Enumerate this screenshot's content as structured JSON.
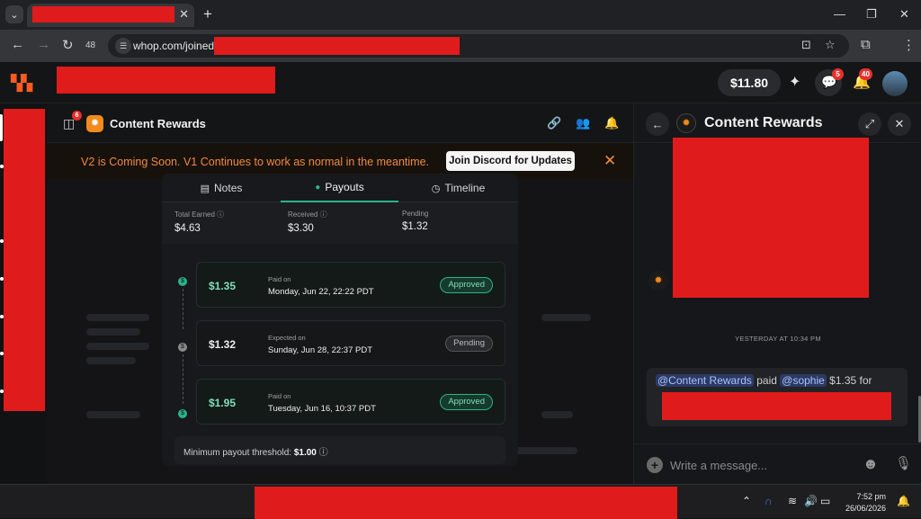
{
  "browser": {
    "tab_close": "✕",
    "new_tab": "+",
    "tab_count": "48",
    "url_prefix": "whop.com/joined/",
    "window_controls": {
      "minimize": "—",
      "restore": "❐",
      "close": "✕"
    }
  },
  "header": {
    "balance": "$11.80",
    "chat_badge": "5",
    "notif_badge": "40"
  },
  "main": {
    "panel_badge": "6",
    "app_title": "Content Rewards",
    "banner_text": "V2 is Coming Soon. V1 Continues to work as normal in the meantime.",
    "banner_button": "Join Discord for Updates",
    "tabs": [
      {
        "label": "Notes",
        "icon": "notes-icon"
      },
      {
        "label": "Payouts",
        "icon": "money-bag-icon"
      },
      {
        "label": "Timeline",
        "icon": "clock-icon"
      }
    ],
    "stats": [
      {
        "label": "Total Earned",
        "value": "$4.63"
      },
      {
        "label": "Received",
        "value": "$3.30"
      },
      {
        "label": "Pending",
        "value": "$1.32"
      }
    ],
    "payouts": [
      {
        "amount": "$1.35",
        "sublabel": "Paid on",
        "date": "Monday, Jun 22, 22:22 PDT",
        "status": "Approved"
      },
      {
        "amount": "$1.32",
        "sublabel": "Expected on",
        "date": "Sunday, Jun 28, 22:37 PDT",
        "status": "Pending"
      },
      {
        "amount": "$1.95",
        "sublabel": "Paid on",
        "date": "Tuesday, Jun 16, 10:37 PDT",
        "status": "Approved"
      }
    ],
    "threshold_label": "Minimum payout threshold:",
    "threshold_value": "$1.00"
  },
  "chat": {
    "title": "Content Rewards",
    "day_separator": "YESTERDAY AT 10:34 PM",
    "message": {
      "mention1": "@Content Rewards",
      "paid": " paid ",
      "mention2": "@sophie",
      "rest": " $1.35 for"
    },
    "placeholder": "Write a message..."
  },
  "taskbar": {
    "time": "7:52 pm",
    "date": "26/06/2026"
  },
  "colors": {
    "accent_green": "#2ab38a",
    "banner_orange": "#f08a40",
    "brand_orange": "#ff5a1f",
    "badge_red": "#e5322d"
  }
}
